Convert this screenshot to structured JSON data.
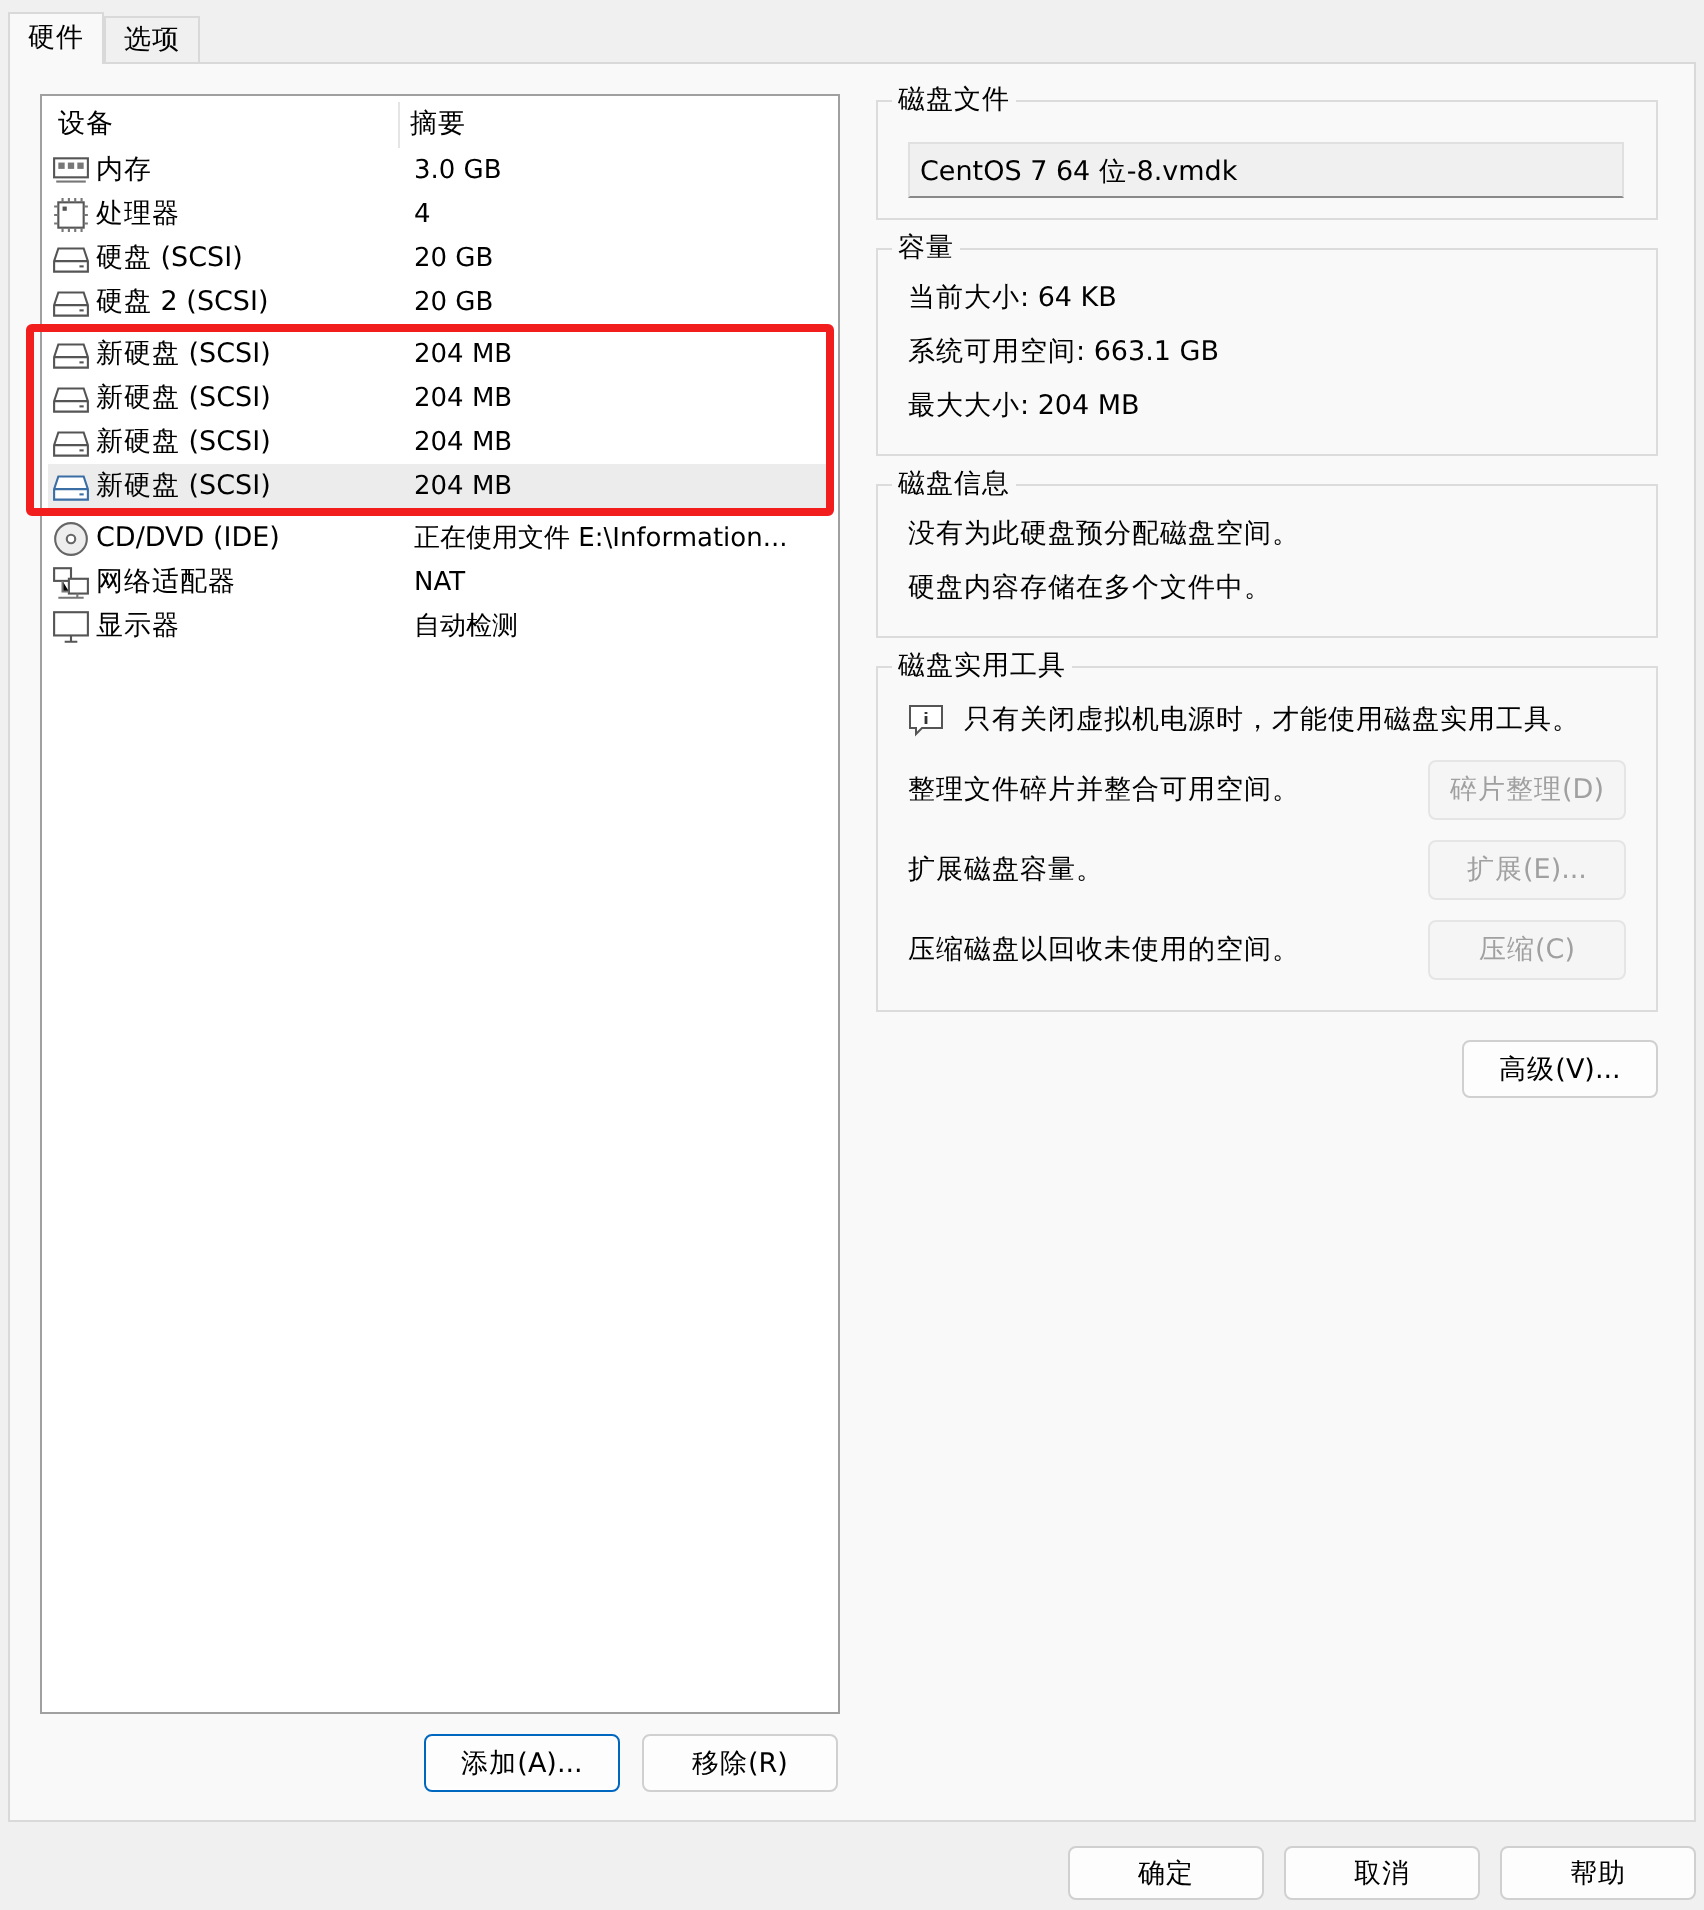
{
  "tabs": [
    {
      "label": "硬件",
      "selected": true
    },
    {
      "label": "选项",
      "selected": false
    }
  ],
  "devices": {
    "columns": [
      "设备",
      "摘要"
    ],
    "rows": [
      {
        "kind": "memory",
        "device": "内存",
        "summary": "3.0 GB",
        "selected": false,
        "highlighted": false
      },
      {
        "kind": "cpu",
        "device": "处理器",
        "summary": "4",
        "selected": false,
        "highlighted": false
      },
      {
        "kind": "disk",
        "device": "硬盘 (SCSI)",
        "summary": "20 GB",
        "selected": false,
        "highlighted": false
      },
      {
        "kind": "disk",
        "device": "硬盘 2 (SCSI)",
        "summary": "20 GB",
        "selected": false,
        "highlighted": false
      },
      {
        "kind": "disk",
        "device": "新硬盘 (SCSI)",
        "summary": "204 MB",
        "selected": false,
        "highlighted": true
      },
      {
        "kind": "disk",
        "device": "新硬盘 (SCSI)",
        "summary": "204 MB",
        "selected": false,
        "highlighted": true
      },
      {
        "kind": "disk",
        "device": "新硬盘 (SCSI)",
        "summary": "204 MB",
        "selected": false,
        "highlighted": true
      },
      {
        "kind": "disk",
        "device": "新硬盘 (SCSI)",
        "summary": "204 MB",
        "selected": true,
        "highlighted": true
      },
      {
        "kind": "cd",
        "device": "CD/DVD (IDE)",
        "summary": "正在使用文件 E:\\Information...",
        "selected": false,
        "highlighted": false
      },
      {
        "kind": "network",
        "device": "网络适配器",
        "summary": "NAT",
        "selected": false,
        "highlighted": false
      },
      {
        "kind": "monitor",
        "device": "显示器",
        "summary": "自动检测",
        "selected": false,
        "highlighted": false
      }
    ],
    "buttons": [
      "添加(A)...",
      "移除(R)"
    ]
  },
  "disk_file": {
    "title": "磁盘文件",
    "value": "CentOS 7 64 位-8.vmdk"
  },
  "capacity": {
    "title": "容量",
    "lines": [
      "当前大小: 64 KB",
      "系统可用空间: 663.1 GB",
      "最大大小: 204 MB"
    ]
  },
  "disk_info": {
    "title": "磁盘信息",
    "lines": [
      "没有为此硬盘预分配磁盘空间。",
      "硬盘内容存储在多个文件中。"
    ]
  },
  "utilities": {
    "title": "磁盘实用工具",
    "note": "只有关闭虚拟机电源时，才能使用磁盘实用工具。",
    "actions": [
      {
        "text": "整理文件碎片并整合可用空间。",
        "button": "碎片整理(D)",
        "disabled": true
      },
      {
        "text": "扩展磁盘容量。",
        "button": "扩展(E)...",
        "disabled": true
      },
      {
        "text": "压缩磁盘以回收未使用的空间。",
        "button": "压缩(C)",
        "disabled": true
      }
    ]
  },
  "advanced_button": "高级(V)...",
  "dialog_buttons": [
    {
      "label": "确定",
      "default": false
    },
    {
      "label": "取消",
      "default": false
    },
    {
      "label": "帮助",
      "default": false
    }
  ]
}
